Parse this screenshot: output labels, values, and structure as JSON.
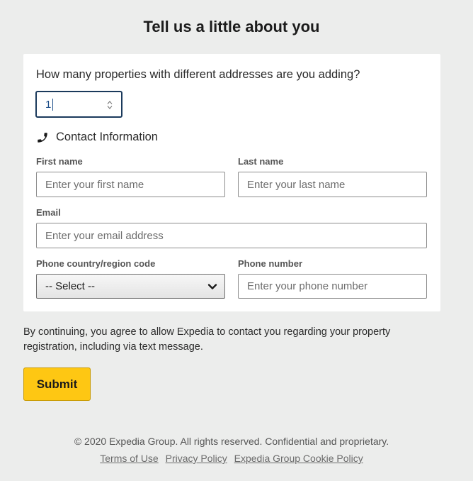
{
  "page": {
    "title": "Tell us a little about you"
  },
  "properties": {
    "question": "How many properties with different addresses are you adding?",
    "count_value": "1"
  },
  "contact": {
    "heading": "Contact Information",
    "icon": "phone-icon",
    "first_name": {
      "label": "First name",
      "placeholder": "Enter your first name",
      "value": ""
    },
    "last_name": {
      "label": "Last name",
      "placeholder": "Enter your last name",
      "value": ""
    },
    "email": {
      "label": "Email",
      "placeholder": "Enter your email address",
      "value": ""
    },
    "country_code": {
      "label": "Phone country/region code",
      "selected": "-- Select --"
    },
    "phone_number": {
      "label": "Phone number",
      "placeholder": "Enter your phone number",
      "value": ""
    }
  },
  "consent_text": "By continuing, you agree to allow Expedia to contact you regarding your property registration, including via text message.",
  "submit_label": "Submit",
  "footer": {
    "copyright": "© 2020 Expedia Group. All rights reserved. Confidential and proprietary.",
    "links": [
      "Terms of Use",
      "Privacy Policy",
      "Expedia Group Cookie Policy"
    ]
  },
  "colors": {
    "background": "#ecedec",
    "button": "#fec713",
    "focus_border": "#1b3a5c"
  }
}
